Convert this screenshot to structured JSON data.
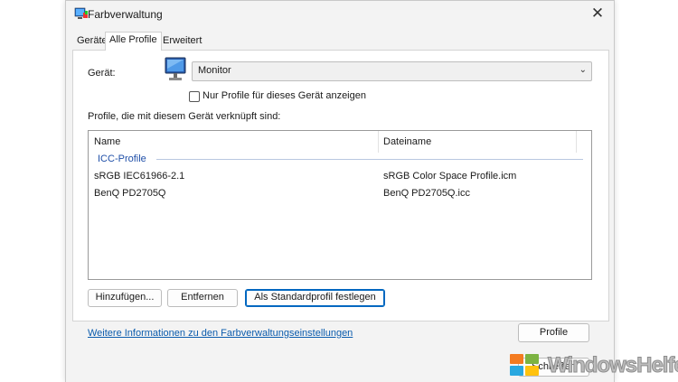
{
  "window": {
    "title": "Farbverwaltung",
    "close_glyph": "✕"
  },
  "tabs": [
    {
      "label": "Geräte",
      "active": false
    },
    {
      "label": "Alle Profile",
      "active": true
    },
    {
      "label": "Erweitert",
      "active": false
    }
  ],
  "device": {
    "label": "Gerät:",
    "selected": "Monitor",
    "icon": "monitor-icon",
    "checkbox_label": "Nur Profile für dieses Gerät anzeigen",
    "checkbox_checked": false
  },
  "profiles": {
    "heading": "Profile, die mit diesem Gerät verknüpft sind:",
    "columns": [
      "Name",
      "Dateiname"
    ],
    "group": "ICC-Profile",
    "rows": [
      {
        "name": "sRGB IEC61966-2.1",
        "file": "sRGB Color Space Profile.icm"
      },
      {
        "name": "BenQ PD2705Q",
        "file": "BenQ PD2705Q.icc"
      }
    ]
  },
  "buttons": {
    "add": "Hinzufügen...",
    "remove": "Entfernen",
    "set_default": "Als Standardprofil festlegen"
  },
  "footer": {
    "link": "Weitere Informationen zu den Farbverwaltungseinstellungen",
    "profile_button": "Profile",
    "close_button": "Schließen"
  },
  "watermark": {
    "text": "WindowsHelfer",
    "tile_colors": [
      "#f47b20",
      "#7cb342",
      "#29a8e0",
      "#ffc20e"
    ]
  }
}
